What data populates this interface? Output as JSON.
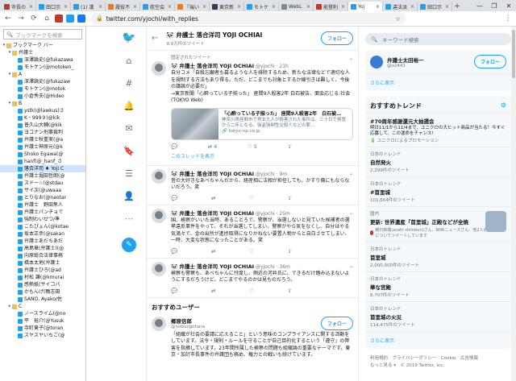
{
  "browser": {
    "tabs": [
      {
        "label": "市長の",
        "color": "#c0392b",
        "active": false
      },
      {
        "label": "田口示",
        "color": "#1da1f2",
        "active": false
      },
      {
        "label": "(1) 漢",
        "color": "#1da1f2",
        "active": false
      },
      {
        "label": "履役不",
        "color": "#e67e22",
        "active": false
      },
      {
        "label": "航空会",
        "color": "#1da1f2",
        "active": false
      },
      {
        "label": "『瑞い",
        "color": "#e67e22",
        "active": false
      },
      {
        "label": "東京新",
        "color": "#2c3e50",
        "active": false
      },
      {
        "label": "モトケ",
        "color": "#1da1f2",
        "active": false
      },
      {
        "label": "WebL",
        "color": "#7f8c8d",
        "active": false
      },
      {
        "label": "能登利",
        "color": "#c0392b",
        "active": false
      },
      {
        "label": "Yoj",
        "color": "#1da1f2",
        "active": true
      },
      {
        "label": "違法派",
        "color": "#1da1f2",
        "active": false
      },
      {
        "label": "田口示",
        "color": "#1da1f2",
        "active": false
      }
    ],
    "new_tab": "+",
    "window_buttons": [
      "—",
      "❐",
      "✕"
    ],
    "url": "twitter.com/yjochi/with_replies"
  },
  "bookmarks": {
    "search_placeholder": "ブックマークを検索",
    "items": [
      {
        "indent": 0,
        "toggle": "▾",
        "kind": "folder",
        "label": "ブックマーク バー"
      },
      {
        "indent": 1,
        "toggle": "▾",
        "kind": "folder",
        "label": "弁護士"
      },
      {
        "indent": 2,
        "toggle": "",
        "kind": "tw",
        "label": "深澤論史(@fukazawa"
      },
      {
        "indent": 2,
        "toggle": "",
        "kind": "tw",
        "label": "モトケン(@motoken_"
      },
      {
        "indent": 1,
        "toggle": "▾",
        "kind": "folder",
        "label": "A"
      },
      {
        "indent": 2,
        "toggle": "",
        "kind": "tw",
        "label": "深澤論史(@fukazaw"
      },
      {
        "indent": 2,
        "toggle": "",
        "kind": "tw",
        "label": "モトケン(@motok"
      },
      {
        "indent": 2,
        "toggle": "",
        "kind": "tw",
        "label": "小倉秀夫(@Hideo"
      },
      {
        "indent": 1,
        "toggle": "▾",
        "kind": "folder",
        "label": "B"
      },
      {
        "indent": 2,
        "toggle": "",
        "kind": "tw",
        "label": "ystk(@lawkus)さ"
      },
      {
        "indent": 2,
        "toggle": "",
        "kind": "tw",
        "label": "K・999９(@kik"
      },
      {
        "indent": 2,
        "toggle": "",
        "kind": "tw",
        "label": "普久山大輔(@kik"
      },
      {
        "indent": 2,
        "toggle": "",
        "kind": "tw",
        "label": "ヨコナン刑事裁判"
      },
      {
        "indent": 2,
        "toggle": "",
        "kind": "tw",
        "label": "弁護士秋重実(@a"
      },
      {
        "indent": 2,
        "toggle": "",
        "kind": "tw",
        "label": "弁護士神原元(@k"
      },
      {
        "indent": 2,
        "toggle": "",
        "kind": "tw",
        "label": "Shoko Egawa(@"
      },
      {
        "indent": 2,
        "toggle": "",
        "kind": "tw",
        "label": "hanf(@_hanf_さ"
      },
      {
        "indent": 2,
        "toggle": "",
        "kind": "tw",
        "label": "落合洋司 ♦ Yoji C",
        "selected": true
      },
      {
        "indent": 2,
        "toggle": "",
        "kind": "tw",
        "label": "弁護士堀田哲朗(@"
      },
      {
        "indent": 2,
        "toggle": "",
        "kind": "tw",
        "label": "スドー☆(@stdau"
      },
      {
        "indent": 2,
        "toggle": "",
        "kind": "tw",
        "label": "サイ次(@uwaaa"
      },
      {
        "indent": 2,
        "toggle": "",
        "kind": "tw",
        "label": "とりなお(@naotar"
      },
      {
        "indent": 2,
        "toggle": "",
        "kind": "tw",
        "label": "弁護士　野田隼人"
      },
      {
        "indent": 2,
        "toggle": "",
        "kind": "tw",
        "label": "弁護士パンチョで"
      },
      {
        "indent": 2,
        "toggle": "",
        "kind": "tw",
        "label": "強制わいせつ/準"
      },
      {
        "indent": 2,
        "toggle": "",
        "kind": "tw",
        "label": "こたびょん(@kotae"
      },
      {
        "indent": 2,
        "toggle": "",
        "kind": "tw",
        "label": "坂本正幸(@sakan"
      },
      {
        "indent": 2,
        "toggle": "",
        "kind": "tw",
        "label": "弁護士あだちあだ"
      },
      {
        "indent": 2,
        "toggle": "",
        "kind": "tw",
        "label": "高島章(弁護士)(@"
      },
      {
        "indent": 2,
        "toggle": "",
        "kind": "tw",
        "label": "向原総合法律事務"
      },
      {
        "indent": 2,
        "toggle": "",
        "kind": "tw",
        "label": "橋本太地(弁護士"
      },
      {
        "indent": 2,
        "toggle": "",
        "kind": "tw",
        "label": "弁護士ひろ(@ad"
      },
      {
        "indent": 2,
        "toggle": "",
        "kind": "tw",
        "label": "村松 謙(@kmurai"
      },
      {
        "indent": 2,
        "toggle": "",
        "kind": "tw",
        "label": "感熱紙(サイコパ"
      },
      {
        "indent": 2,
        "toggle": "",
        "kind": "tw",
        "label": "かもんげ(鴨志田"
      },
      {
        "indent": 2,
        "toggle": "",
        "kind": "tw",
        "label": "SANO, Ayako/佐"
      },
      {
        "indent": 1,
        "toggle": "▸",
        "kind": "folder",
        "label": "C"
      },
      {
        "indent": 2,
        "toggle": "",
        "kind": "tw",
        "label": "ノースライム(@no"
      },
      {
        "indent": 2,
        "toggle": "",
        "kind": "tw",
        "label": "平　裕介(@Yusuk"
      },
      {
        "indent": 2,
        "toggle": "",
        "kind": "tw",
        "label": "寺町東子(@toran"
      },
      {
        "indent": 2,
        "toggle": "",
        "kind": "tw",
        "label": "スヤスヤいちご(@"
      }
    ]
  },
  "profile": {
    "name": "🐼 弁護士 落合洋司 YOJI OCHIAI",
    "tweet_count": "9.9万件のツイート",
    "follow_label": "フォロー"
  },
  "tweets": [
    {
      "pinned": "固定されたツイート",
      "name": "🐼 弁護士 落合洋司 YOJI OCHIAI",
      "handle": "@yjochi · 21h",
      "text": "自分コメ「自殺忘願者も募るような人を排除するため、新たな法律などで適切な人を規制する方法もあり得る。ただ、どこまでも対象とするか線引きは難しく、今後の議論が必要だ」\n→東京新聞「心酔っている子揃った」 産間9人殺害2年 白石被告、面会応じる:社会(TOKYO Web)",
      "card_title": "「心酔っている子揃った」 座間9人殺害2年　白石被…",
      "card_desc": "神奈川県座間市で男女九人が殺害された事件は、三十日で発覚から二年となる。強盗強制性交殺人などの罪…",
      "card_url": "🔗 tokyo-np.co.jp",
      "reply": "💬",
      "retweet": "⇄ 4",
      "like": "♡ 5",
      "share": "⇪",
      "thread_link": "このスレッドを表示"
    },
    {
      "name": "🐼 弁護士 落合洋司 YOJI OCHIAI",
      "handle": "@yjochi · 9m",
      "text": "昔の大好きなあべちゃんだから、経産相に法相が担任しても、かすり傷にもならないだろう。笑",
      "reply": "💬",
      "retweet": "⇄",
      "like": "♡",
      "share": "⇪"
    },
    {
      "name": "🐼 弁護士 落合洋司 YOJI OCHIAI",
      "handle": "@yjochi · 25m",
      "text": "国、検察がいいた当時、あることろで、警察が、当選しないと見ていた候補者の選挙違反事件をやって、それが当選してしまい、警察がやら気をなくし、自分はやる気満々で、金の出所が進捗取得になりかねない要置人物からと自白させてしまい、一時、大変な状態になったことがある。笑",
      "reply": "💬",
      "retweet": "⇄",
      "like": "♡",
      "share": "⇪"
    },
    {
      "name": "🐼 弁護士 落合洋司 YOJI OCHIAI",
      "handle": "@yjochi · 36m",
      "text": "検察も警察も、あべちゃんに忖度し、側近の河井氏に、できるだけ踏み込まないようにするだろうけど、どこまでやるのかは見ものだろう。",
      "reply": "💬",
      "retweet": "⇄",
      "like": "♡",
      "share": "⇪"
    }
  ],
  "recommended": {
    "heading": "おすすめユーザー",
    "user": {
      "name": "郷原信郎",
      "handle": "@nobuogohara",
      "text": "「組織が社会の要請に応えること」という意味のコンプライアンスに関する活動をしています。法令・規則・ルールを守ることが自己目的化するという「遵守」の弊害を指摘しています。23年間所属した検察の問題も組織論の重要なテーマです。東京・加計市長事件の弁護団も務め、権力との戦いも続けています。",
      "follow_label": "フォロー"
    }
  },
  "sidebar_right": {
    "search_placeholder": "キーワード検索",
    "promo_name": "弁護士太田裕一",
    "promo_handle": "@o2441",
    "promo_follow": "フォロー",
    "more_label": "さらに表示",
    "trends_heading": "おすすめトレンド",
    "trends": [
      {
        "category": "",
        "name": "#70周年感謝還元大抽選会",
        "desc": "明日11/1から11/4まで、ユニクロの大ヒット商品が当たる！今すぐ応募して、この運命をチャンス!",
        "stat": "🔋 ユニクロによるプロモーション",
        "image": false
      },
      {
        "category": "日本のトレンド",
        "name": "自然発火",
        "desc": "",
        "stat": "2,299件のツイート",
        "image": false
      },
      {
        "category": "日本のトレンド",
        "name": "#首里城",
        "desc": "",
        "stat": "101,664件のツイート",
        "image": false
      },
      {
        "category": "国内",
        "name": "更新: 世界遺産「首里城」正殿などが全焼",
        "desc": "",
        "stat": "",
        "image": true,
        "news": "朝日新聞(asahi shimbun)さん、NHKニュースさん、他2人がこの話題についてツイートしています"
      },
      {
        "category": "日本のトレンド",
        "name": "首里城",
        "desc": "",
        "stat": "2,000,000件のツイート",
        "image": false
      },
      {
        "category": "日本のトレンド",
        "name": "華な宮殿",
        "desc": "",
        "stat": "8,707件のツイート",
        "image": false
      },
      {
        "category": "日本のトレンド",
        "name": "首里城の火災",
        "desc": "",
        "stat": "114,475件のツイート",
        "image": false
      }
    ],
    "trends_more": "さらに表示",
    "footer": "利用規約　プライバシーポリシー　Cookie　広告情報\nもっと見る ▾　© 2019 Twitter, Inc."
  }
}
